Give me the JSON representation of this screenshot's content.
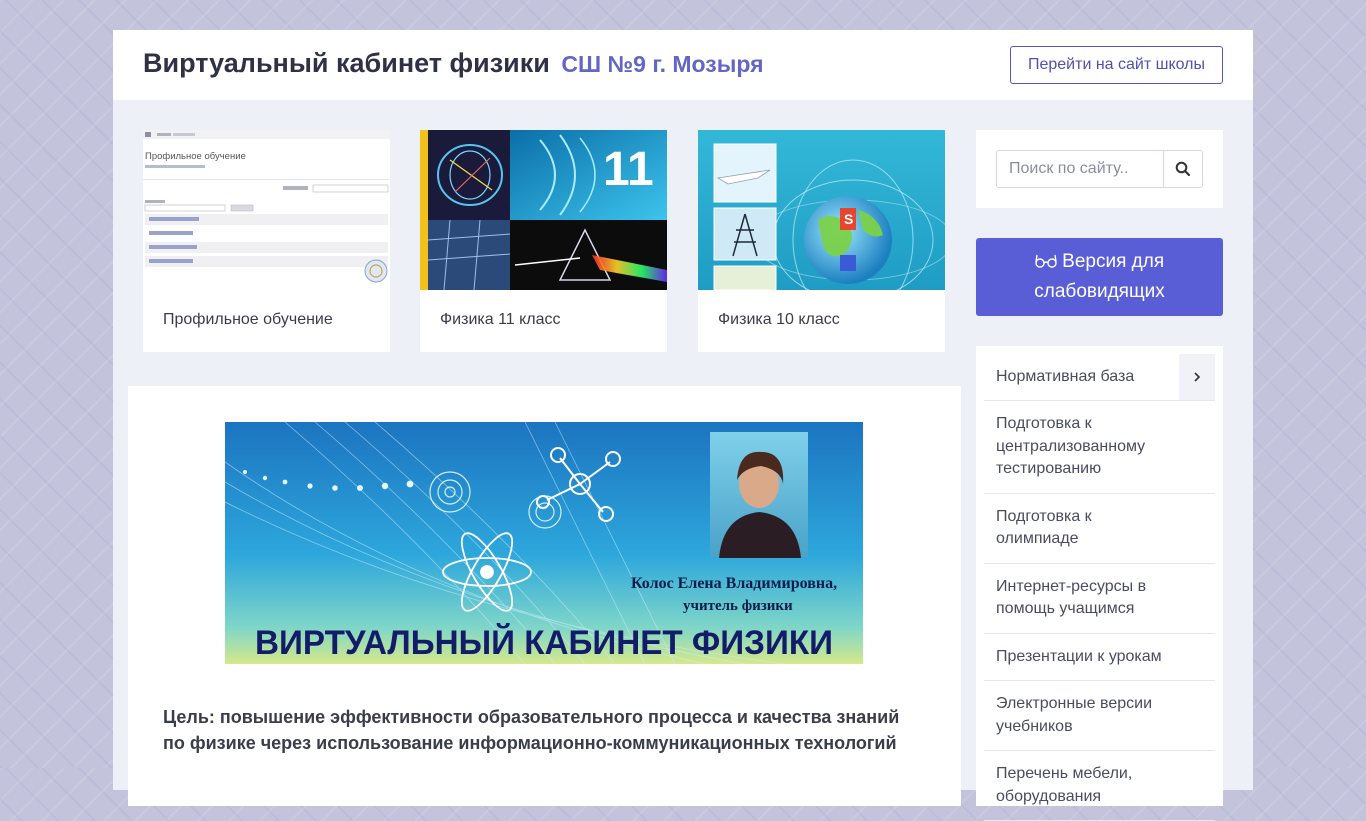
{
  "header": {
    "title": "Виртуальный кабинет физики",
    "subtitle": "СШ №9 г. Мозыря",
    "school_link": "Перейти на сайт школы"
  },
  "cards": [
    {
      "caption": "Профильное обучение",
      "thumb_title": "Профильное обучение"
    },
    {
      "caption": "Физика 11 класс",
      "thumb_number": "11"
    },
    {
      "caption": "Физика 10 класс"
    }
  ],
  "banner": {
    "teacher_name": "Колос Елена Владимировна,",
    "teacher_role": "учитель физики",
    "title": "ВИРТУАЛЬНЫЙ КАБИНЕТ ФИЗИКИ"
  },
  "goal_text": "Цель: повышение эффективности образовательного процесса и качества знаний по физике через использование информационно-коммуникационных технологий",
  "search": {
    "placeholder": "Поиск по сайту.."
  },
  "vision_button": {
    "line1": "Версия для",
    "line2": "слабовидящих"
  },
  "menu": {
    "items": [
      {
        "label": "Нормативная база"
      },
      {
        "label": "Подготовка к централизованному тестированию"
      },
      {
        "label": "Подготовка к олимпиаде"
      },
      {
        "label": "Интернет-ресурсы в помощь учащимся"
      },
      {
        "label": "Презентации к урокам"
      },
      {
        "label": "Электронные версии учебников"
      },
      {
        "label": "Перечень мебели, оборудования"
      }
    ]
  },
  "colors": {
    "accent": "#5a5ed6",
    "subtitle": "#6366c6",
    "background": "#c3c4dc"
  }
}
